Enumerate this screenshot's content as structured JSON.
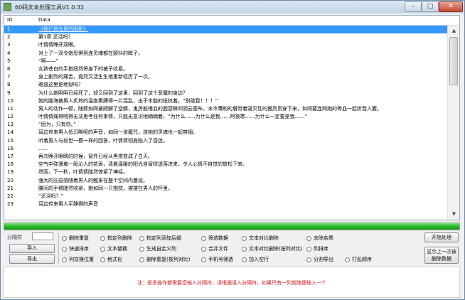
{
  "window": {
    "title": "60码文本处理工具V1.0.32",
    "minimize": "–",
    "maximize": "□",
    "close": "✕"
  },
  "grid": {
    "columns": [
      "ID",
      "Data"
    ],
    "rows": [
      {
        "id": "1",
        "text": "《他们曾光里的阴影》",
        "selected": true
      },
      {
        "id": "2",
        "text": "第1章 还活吗？"
      },
      {
        "id": "3",
        "text": "    叶倩倩睁开双眼。"
      },
      {
        "id": "4",
        "text": "    对上了一双令她恐惧到连灵魂都在颤抖的眸子。"
      },
      {
        "id": "5",
        "text": "    “啊——”"
      },
      {
        "id": "6",
        "text": "    女孩苍白的手指纽然将身下的被子纹紧。"
      },
      {
        "id": "7",
        "text": "    身上剧烈的痛苦，竟然又活生生地重新经历了一次。"
      },
      {
        "id": "8",
        "text": "    难道这里是地狱吗？"
      },
      {
        "id": "9",
        "text": "    为什么她明明已经死了，却又回到了这里，回到了这个恶魔的身边？"
      },
      {
        "id": "10",
        "text": "    她的脑海被男人炙热的温度裹膊得一片混乱，出于本能的抵抗着，“别碰我！！！”"
      },
      {
        "id": "11",
        "text": "    男人的动作一顿，随即如同被顺解了逆鳞，鬼厉般嗜血的面容瞬间阴云密布，冰冷薄削的眉带着毁灭性的狠厉贯穿下来，如同要连同她的骨血一起折吞入腹。"
      },
      {
        "id": "12",
        "text": "    叶倩倩痛得喘得无法思考任何事情，只能无意识地喃喃着，“为什么……为什么是我……阿夜寒……为什么一定要是我……”"
      },
      {
        "id": "13",
        "text": "    “因为，只有你。”"
      },
      {
        "id": "14",
        "text": "    耳边传来男人低沉嘶哑的声音，如同一道魔咒，连她的灵魂也一起禁锢。"
      },
      {
        "id": "15",
        "text": "    听着男人与前世一模一样的回答，叶倩倩彻底陷入了昏迷。"
      },
      {
        "id": "16",
        "text": "    ……"
      },
      {
        "id": "17",
        "text": "    再次睁开眼睛的时候，窗外已经从黑夜变成了白天。"
      },
      {
        "id": "18",
        "text": "    空气中弥漫着一股沁人的花香，清晨温暖的阳光自窗棂透落进来，令人心情不自觉的放松下来。"
      },
      {
        "id": "19",
        "text": "    然而，下一秒，叶倩倩陡然惊紧了神经。"
      },
      {
        "id": "20",
        "text": "    强大的压迫感随着男人的醒来在整个空间内蔓延。"
      },
      {
        "id": "21",
        "text": "    腰间的手臂陡然收紧，她如同一只抱枕，被搂在男人的怀里。"
      },
      {
        "id": "22",
        "text": "    “还活吗？”"
      },
      {
        "id": "23",
        "text": "    耳边传来男人平静得的声音"
      }
    ]
  },
  "progress": {
    "value": 1.0
  },
  "panel": {
    "separator_label": "分隔符",
    "separator_value": "",
    "import_label": "导入",
    "export_label": "导出",
    "options_row1": [
      "删除重复",
      "指定列删除",
      "指定列添加后缀",
      "筛选数据",
      "文本对比删除",
      "去除杂质"
    ],
    "options_row2": [
      "快速排序",
      "文本替换",
      "生成自定义列",
      "合并文件",
      "文本对比删除(按列对比)",
      "列排序"
    ],
    "options_row3": [
      "列交换位置",
      "格式化",
      "删除重复(按列对比)",
      "手机号筛选",
      "加入空行",
      "分割导出",
      "打乱顺序"
    ],
    "start_label": "开始处理",
    "show_label": "显示上一次被删除数据"
  },
  "note": "注：很多操作都需要您输入分隔符，请根据填入分隔符，如果只有一列就随便输入一个"
}
